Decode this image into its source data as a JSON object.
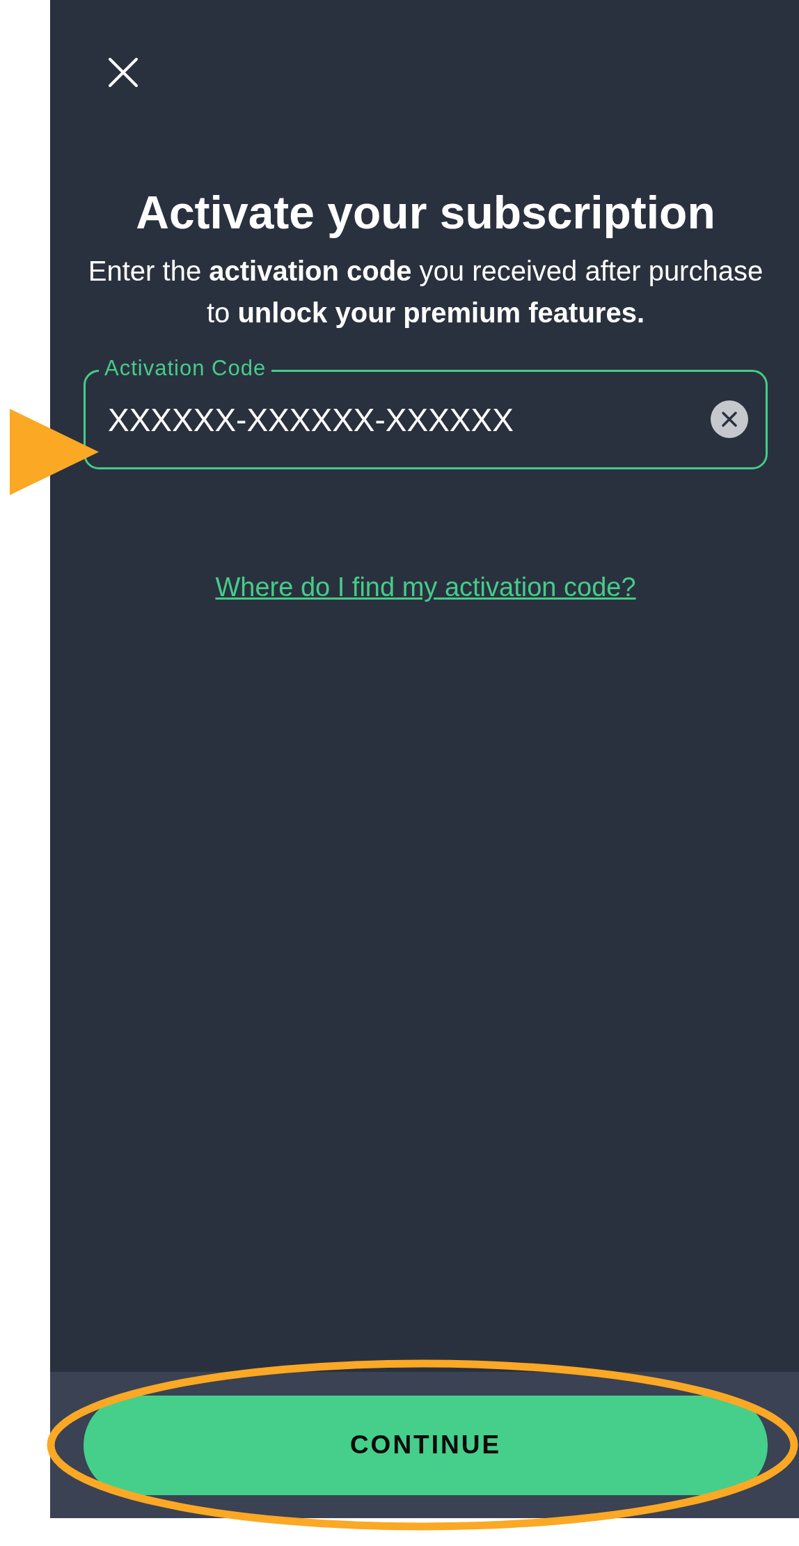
{
  "dialog": {
    "title": "Activate your subscription",
    "description": "Enter the **activation code** you received after purchase to **unlock your premium features.**",
    "code_field": {
      "label": "Activation Code",
      "value": "XXXXXX-XXXXXX-XXXXXX"
    },
    "help_link": "Where do I find my activation code?",
    "continue_button": "CONTINUE"
  }
}
